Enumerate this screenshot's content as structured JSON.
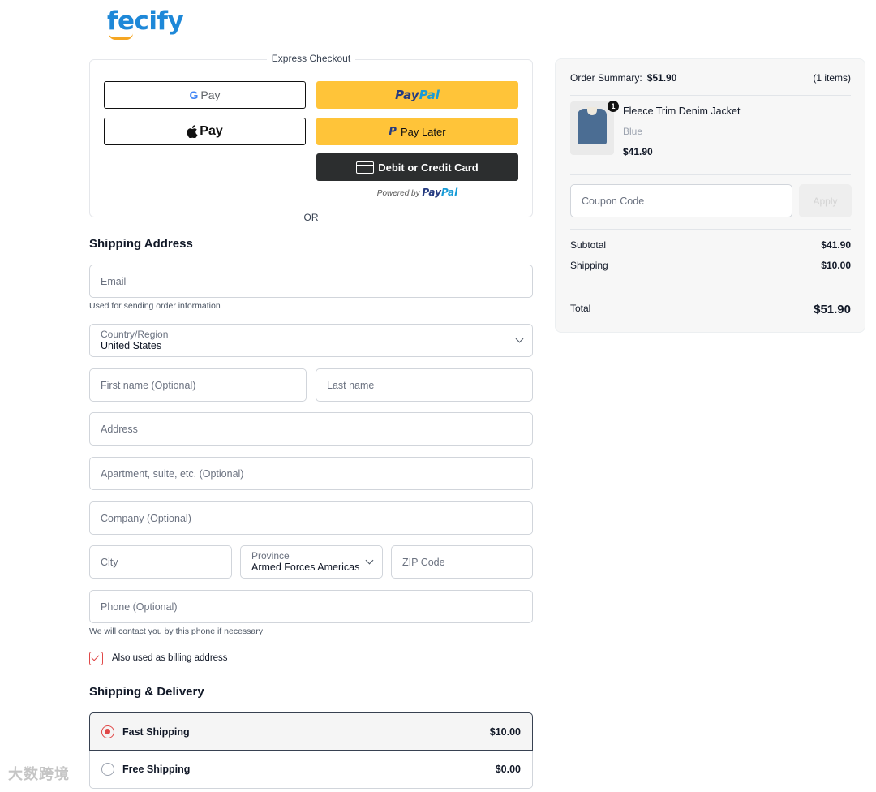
{
  "brand": {
    "logo": "fecify"
  },
  "express": {
    "title": "Express Checkout",
    "gpay_g": "G",
    "gpay_label": "Pay",
    "apple_label": "Pay",
    "paypal_a": "Pay",
    "paypal_b": "Pal",
    "paylater_icon": "P",
    "paylater_label": "Pay Later",
    "card_label": "Debit or Credit Card",
    "powered_prefix": "Powered by",
    "powered_a": "Pay",
    "powered_b": "Pal",
    "or": "OR"
  },
  "shipping_address": {
    "title": "Shipping Address",
    "email_placeholder": "Email",
    "email_hint": "Used for sending order information",
    "country_label": "Country/Region",
    "country_value": "United States",
    "first_name_placeholder": "First name (Optional)",
    "last_name_placeholder": "Last name",
    "address_placeholder": "Address",
    "apartment_placeholder": "Apartment, suite, etc. (Optional)",
    "company_placeholder": "Company (Optional)",
    "city_placeholder": "City",
    "province_label": "Province",
    "province_value": "Armed Forces Americas",
    "zip_placeholder": "ZIP Code",
    "phone_placeholder": "Phone (Optional)",
    "phone_hint": "We will contact you by this phone if necessary",
    "billing_checkbox_label": "Also used as billing address",
    "billing_checked": true
  },
  "delivery": {
    "title": "Shipping & Delivery",
    "options": [
      {
        "label": "Fast Shipping",
        "price": "$10.00",
        "selected": true
      },
      {
        "label": "Free Shipping",
        "price": "$0.00",
        "selected": false
      }
    ]
  },
  "summary": {
    "label": "Order Summary:",
    "amount": "$51.90",
    "count": "(1 items)",
    "item": {
      "quantity": "1",
      "name": "Fleece Trim Denim Jacket",
      "variant": "Blue",
      "price": "$41.90",
      "image_icon": "denim-jacket-image"
    },
    "coupon_placeholder": "Coupon Code",
    "apply_label": "Apply",
    "subtotal_label": "Subtotal",
    "subtotal_value": "$41.90",
    "shipping_label": "Shipping",
    "shipping_value": "$10.00",
    "total_label": "Total",
    "total_value": "$51.90"
  },
  "watermark": "大数跨境",
  "colors": {
    "accent": "#e04848",
    "paypal_yellow": "#ffc439",
    "card_dark": "#2c2e2f",
    "logo_blue": "#1e88d8"
  }
}
